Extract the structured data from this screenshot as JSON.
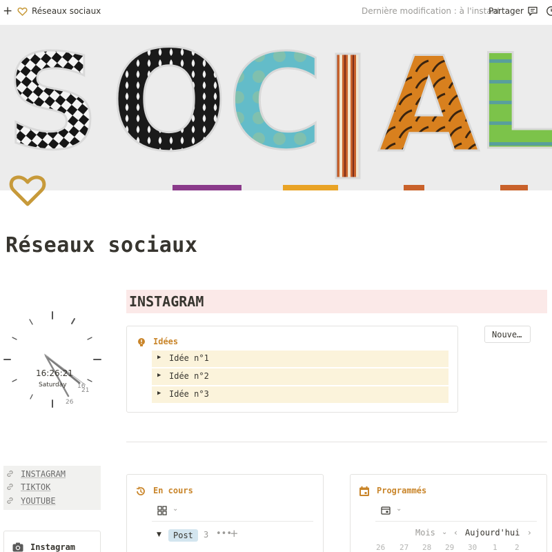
{
  "topbar": {
    "page_title": "Réseaux sociaux",
    "last_modified": "Dernière modification : à l'instant",
    "share_label": "Partager"
  },
  "cover": {
    "title_text": "SOCIAL"
  },
  "page": {
    "title": "Réseaux sociaux"
  },
  "clock": {
    "time": "16:26:21",
    "day": "Saturday",
    "hand_labels": [
      "16",
      "21",
      "26"
    ]
  },
  "instagram": {
    "heading": "INSTAGRAM",
    "new_button": "Nouve…",
    "ideas": {
      "title": "Idées",
      "items": [
        "Idée n°1",
        "Idée n°2",
        "Idée n°3"
      ]
    }
  },
  "links": {
    "items": [
      "INSTAGRAM",
      "TIKTOK",
      "YOUTUBE"
    ]
  },
  "sidebar_card": {
    "label": "Instagram"
  },
  "en_cours": {
    "title": "En cours",
    "group_label": "Post",
    "group_count": "3"
  },
  "programmes": {
    "title": "Programmés",
    "view_label": "Mois",
    "today_label": "Aujourd'hui",
    "days": [
      "26",
      "27",
      "28",
      "29",
      "30",
      "1",
      "2"
    ]
  },
  "colors": {
    "accent_orange": "#c9852a",
    "heart_gold": "#c79a3a",
    "instagram_heading_bg": "#fbe9e8",
    "ideas_item_bg": "#fbf3db",
    "post_tag_bg": "#d3e5ef"
  },
  "icons": {
    "topbar": [
      "plus-icon",
      "heart-icon",
      "comment-icon",
      "clock-icon"
    ],
    "ideas": "lightbulb-icon",
    "en_cours": "history-icon",
    "programmes": "calendar-icon",
    "links": "link-icon",
    "sidebar_card": "camera-icon"
  }
}
